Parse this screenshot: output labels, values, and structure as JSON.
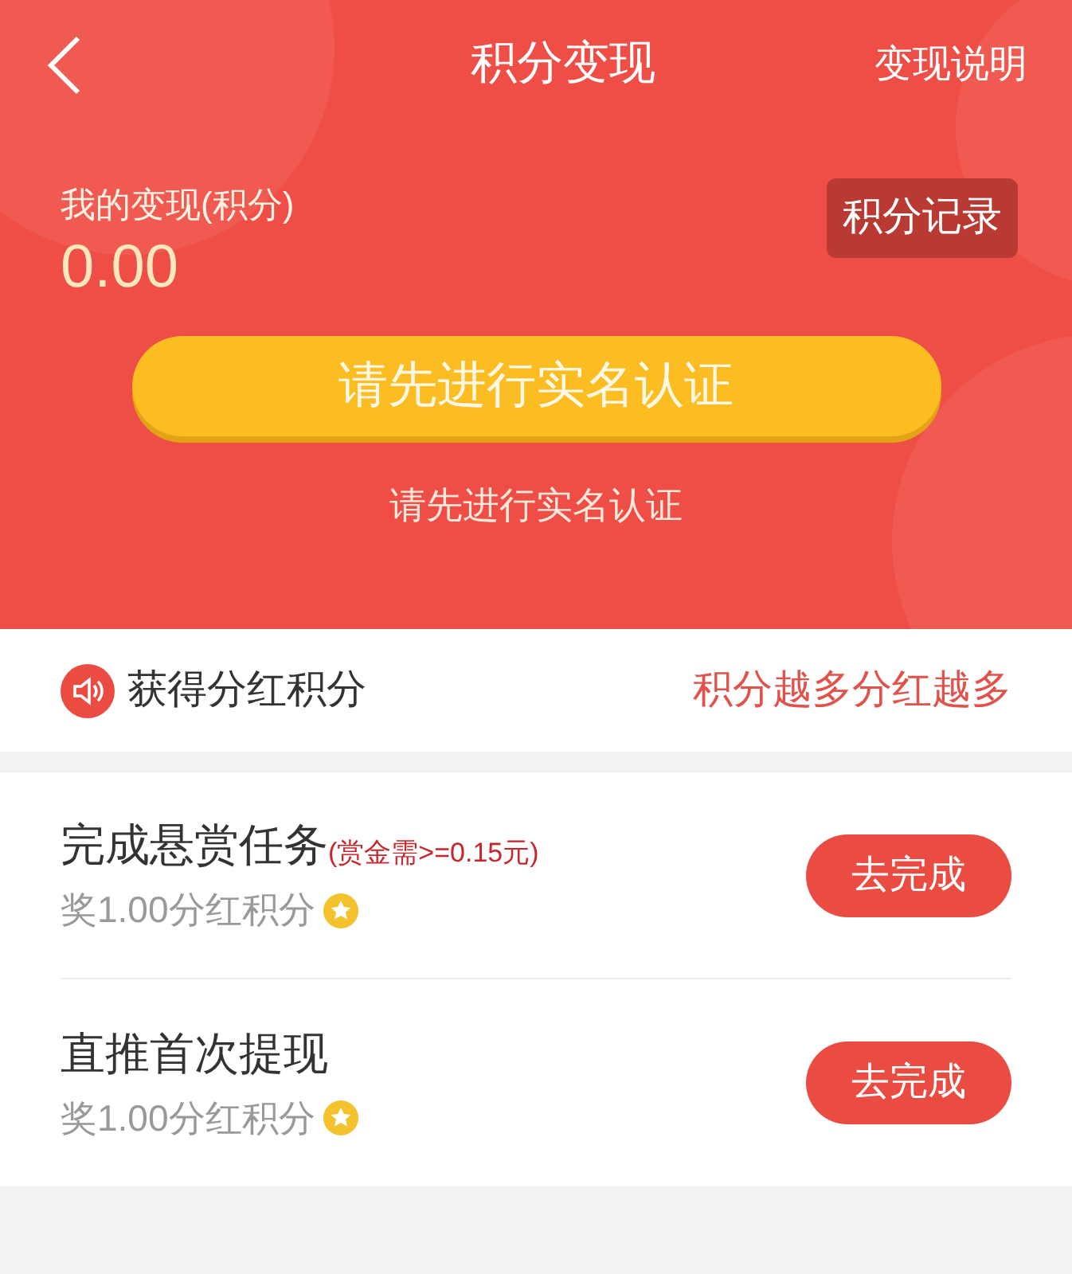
{
  "header": {
    "title": "积分变现",
    "right_link": "变现说明"
  },
  "balance": {
    "label": "我的变现(积分)",
    "value": "0.00",
    "record_button": "积分记录"
  },
  "verify_button": "请先进行实名认证",
  "verify_hint": "请先进行实名认证",
  "notice": {
    "title": "获得分红积分",
    "slogan": "积分越多分红越多"
  },
  "tasks": [
    {
      "title": "完成悬赏任务",
      "condition": "(赏金需>=0.15元)",
      "reward": "奖1.00分红积分",
      "button": "去完成"
    },
    {
      "title": "直推首次提现",
      "reward": "奖1.00分红积分",
      "button": "去完成"
    }
  ]
}
